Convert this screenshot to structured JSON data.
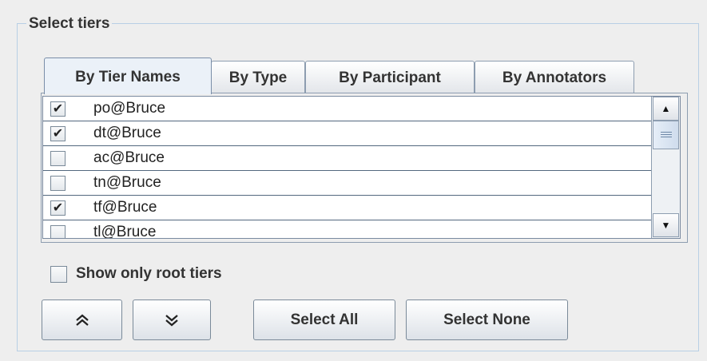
{
  "panel": {
    "title": "Select tiers"
  },
  "tabs": [
    {
      "label": "By Tier Names",
      "active": true
    },
    {
      "label": "By Type",
      "active": false
    },
    {
      "label": "By Participant",
      "active": false
    },
    {
      "label": "By Annotators",
      "active": false
    }
  ],
  "tier_list": {
    "rows": [
      {
        "label": "po@Bruce",
        "checked": true
      },
      {
        "label": "dt@Bruce",
        "checked": true
      },
      {
        "label": "ac@Bruce",
        "checked": false
      },
      {
        "label": "tn@Bruce",
        "checked": false
      },
      {
        "label": "tf@Bruce",
        "checked": true
      },
      {
        "label": "tl@Bruce",
        "checked": false
      }
    ]
  },
  "options": {
    "show_root_label": "Show only root tiers",
    "show_root_checked": false
  },
  "buttons": {
    "up_icon": "double-chevron-up-icon",
    "down_icon": "double-chevron-down-icon",
    "select_all": "Select All",
    "select_none": "Select None"
  },
  "colors": {
    "border": "#b8cfe5",
    "background": "#eeeeee",
    "active_tab": "#ebf1f8"
  }
}
